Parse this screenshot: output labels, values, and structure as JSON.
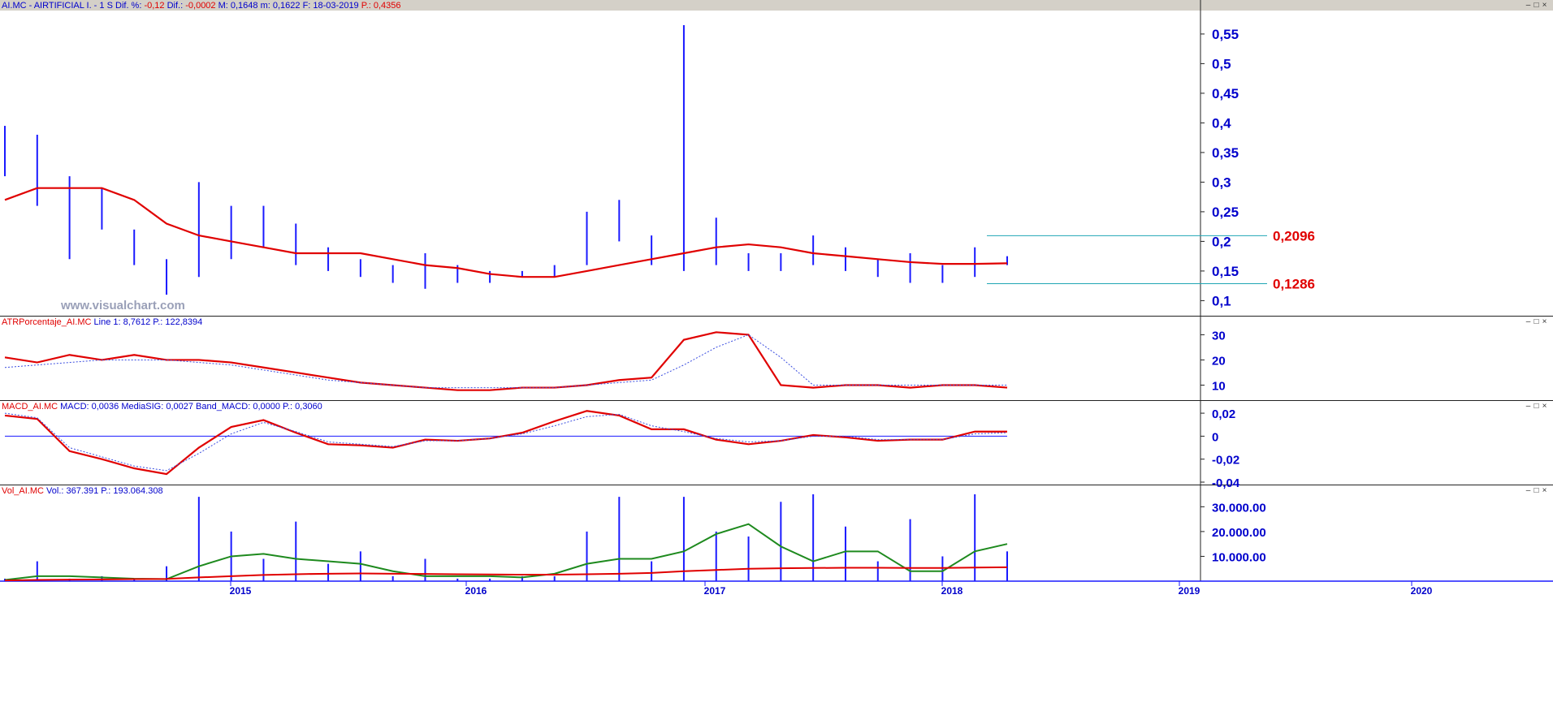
{
  "header": {
    "symbol": "AI.MC - AIRTIFICIAL I. -",
    "period": "1 S",
    "dif_pct_label": "Dif. %:",
    "dif_pct_value": "-0,12",
    "dif_label": "Dif.:",
    "dif_value": "-0,0002",
    "max_label": "M: 0,1648",
    "min_label": "m: 0,1622",
    "date_label": "F: 18-03-2019",
    "p_value": "P.: 0,4356"
  },
  "window_buttons": [
    "–",
    "□",
    "×"
  ],
  "watermark": "www.visualchart.com",
  "years": [
    "2015",
    "2016",
    "2017",
    "2018",
    "2019",
    "2020"
  ],
  "chart_data": [
    {
      "type": "bar",
      "name": "price",
      "ylim": [
        0.08,
        0.58
      ],
      "ticks": [
        "0,55",
        "0,5",
        "0,45",
        "0,4",
        "0,35",
        "0,3",
        "0,25",
        "0,2",
        "0,15",
        "0,1"
      ],
      "tick_values": [
        0.55,
        0.5,
        0.45,
        0.4,
        0.35,
        0.3,
        0.25,
        0.2,
        0.15,
        0.1
      ],
      "levels": [
        {
          "label": "0,2096",
          "value": 0.2096
        },
        {
          "label": "0,1286",
          "value": 0.1286
        }
      ],
      "x": [
        "2014-01",
        "2014-03",
        "2014-05",
        "2014-07",
        "2014-09",
        "2014-11",
        "2015-01",
        "2015-03",
        "2015-05",
        "2015-07",
        "2015-09",
        "2015-11",
        "2016-01",
        "2016-03",
        "2016-05",
        "2016-07",
        "2016-09",
        "2016-11",
        "2017-01",
        "2017-03",
        "2017-05",
        "2017-07",
        "2017-09",
        "2017-11",
        "2018-01",
        "2018-03",
        "2018-05",
        "2018-07",
        "2018-09",
        "2018-11",
        "2019-01",
        "2019-03"
      ],
      "high": [
        0.395,
        0.38,
        0.31,
        0.29,
        0.22,
        0.17,
        0.3,
        0.26,
        0.26,
        0.23,
        0.19,
        0.17,
        0.16,
        0.18,
        0.16,
        0.15,
        0.15,
        0.16,
        0.25,
        0.27,
        0.21,
        0.565,
        0.24,
        0.18,
        0.18,
        0.21,
        0.19,
        0.17,
        0.18,
        0.16,
        0.19,
        0.175
      ],
      "low": [
        0.31,
        0.26,
        0.17,
        0.22,
        0.16,
        0.11,
        0.14,
        0.17,
        0.19,
        0.16,
        0.15,
        0.14,
        0.13,
        0.12,
        0.13,
        0.13,
        0.14,
        0.14,
        0.16,
        0.2,
        0.16,
        0.15,
        0.16,
        0.15,
        0.15,
        0.16,
        0.15,
        0.14,
        0.13,
        0.13,
        0.14,
        0.16
      ],
      "ma": [
        0.27,
        0.29,
        0.29,
        0.29,
        0.27,
        0.23,
        0.21,
        0.2,
        0.19,
        0.18,
        0.18,
        0.18,
        0.17,
        0.16,
        0.155,
        0.145,
        0.14,
        0.14,
        0.15,
        0.16,
        0.17,
        0.18,
        0.19,
        0.195,
        0.19,
        0.18,
        0.175,
        0.17,
        0.165,
        0.162,
        0.162,
        0.163
      ]
    },
    {
      "type": "line",
      "name": "ATRPorcentaje_AI.MC",
      "title_left": "ATRPorcentaje_AI.MC",
      "title_right": "Line 1: 8,7612  P.: 122,8394",
      "ylim": [
        5,
        34
      ],
      "ticks": [
        "30",
        "20",
        "10"
      ],
      "tick_values": [
        30,
        20,
        10
      ],
      "series": [
        {
          "values": [
            21,
            19,
            22,
            20,
            22,
            20,
            20,
            19,
            17,
            15,
            13,
            11,
            10,
            9,
            8,
            8,
            9,
            9,
            10,
            12,
            13,
            28,
            31,
            30,
            10,
            9,
            10,
            10,
            9,
            10,
            10,
            9
          ],
          "color": "#e00000"
        },
        {
          "values": [
            17,
            18,
            19,
            20,
            20,
            20,
            19,
            18,
            16,
            14,
            12,
            11,
            10,
            9,
            9,
            9,
            9,
            9,
            10,
            11,
            12,
            18,
            25,
            30,
            21,
            10,
            10,
            10,
            10,
            10,
            10,
            10
          ],
          "color": "#3b4de0"
        }
      ]
    },
    {
      "type": "line",
      "name": "MACD_AI.MC",
      "title_left": "MACD_AI.MC",
      "title_right": "MACD: 0,0036  MediaSIG: 0,0027  Band_MACD: 0,0000  P.: 0,3060",
      "ylim": [
        -0.04,
        0.025
      ],
      "ticks": [
        "0,02",
        "0",
        "-0,02",
        "-0,04"
      ],
      "tick_values": [
        0.02,
        0,
        -0.02,
        -0.04
      ],
      "series": [
        {
          "values": [
            0.018,
            0.015,
            -0.013,
            -0.02,
            -0.028,
            -0.033,
            -0.01,
            0.008,
            0.014,
            0.003,
            -0.007,
            -0.008,
            -0.01,
            -0.003,
            -0.004,
            -0.002,
            0.003,
            0.013,
            0.022,
            0.018,
            0.006,
            0.006,
            -0.003,
            -0.007,
            -0.004,
            0.001,
            -0.001,
            -0.004,
            -0.003,
            -0.003,
            0.004,
            0.004
          ],
          "color": "#e00000"
        },
        {
          "values": [
            0.02,
            0.016,
            -0.01,
            -0.018,
            -0.026,
            -0.03,
            -0.015,
            0.002,
            0.012,
            0.004,
            -0.005,
            -0.007,
            -0.009,
            -0.004,
            -0.004,
            -0.002,
            0.002,
            0.009,
            0.017,
            0.019,
            0.009,
            0.004,
            -0.002,
            -0.005,
            -0.004,
            0.0,
            0.0,
            -0.003,
            -0.003,
            -0.003,
            0.002,
            0.003
          ],
          "color": "#3b4de0"
        }
      ],
      "zero_line": 0
    },
    {
      "type": "bar",
      "name": "Vol_AI.MC",
      "title_left": "Vol_AI.MC",
      "title_right": "Vol.: 367.391  P.: 193.064.308",
      "ylim": [
        0,
        36000
      ],
      "ticks": [
        "30.000.00",
        "20.000.00",
        "10.000.00"
      ],
      "tick_values": [
        30000,
        20000,
        10000
      ],
      "volume": [
        1000,
        8000,
        1000,
        2000,
        1000,
        6000,
        34000,
        20000,
        9000,
        24000,
        7000,
        12000,
        2000,
        9000,
        1000,
        1000,
        2000,
        2000,
        20000,
        34000,
        8000,
        34000,
        20000,
        18000,
        32000,
        35000,
        22000,
        8000,
        25000,
        10000,
        35000,
        12000
      ],
      "ma_green": [
        500,
        2000,
        2000,
        1500,
        1000,
        800,
        6000,
        10000,
        11000,
        9000,
        8000,
        7000,
        4000,
        2000,
        2000,
        2000,
        1500,
        3000,
        7000,
        9000,
        9000,
        12000,
        19000,
        23000,
        14000,
        8000,
        12000,
        12000,
        4000,
        4000,
        12000,
        15000
      ],
      "ma_red": [
        300,
        500,
        600,
        700,
        800,
        900,
        1500,
        2000,
        2500,
        2800,
        3000,
        3100,
        3000,
        2900,
        2800,
        2700,
        2600,
        2600,
        2800,
        3000,
        3300,
        4000,
        4500,
        5000,
        5200,
        5300,
        5400,
        5400,
        5300,
        5300,
        5500,
        5600
      ]
    }
  ]
}
